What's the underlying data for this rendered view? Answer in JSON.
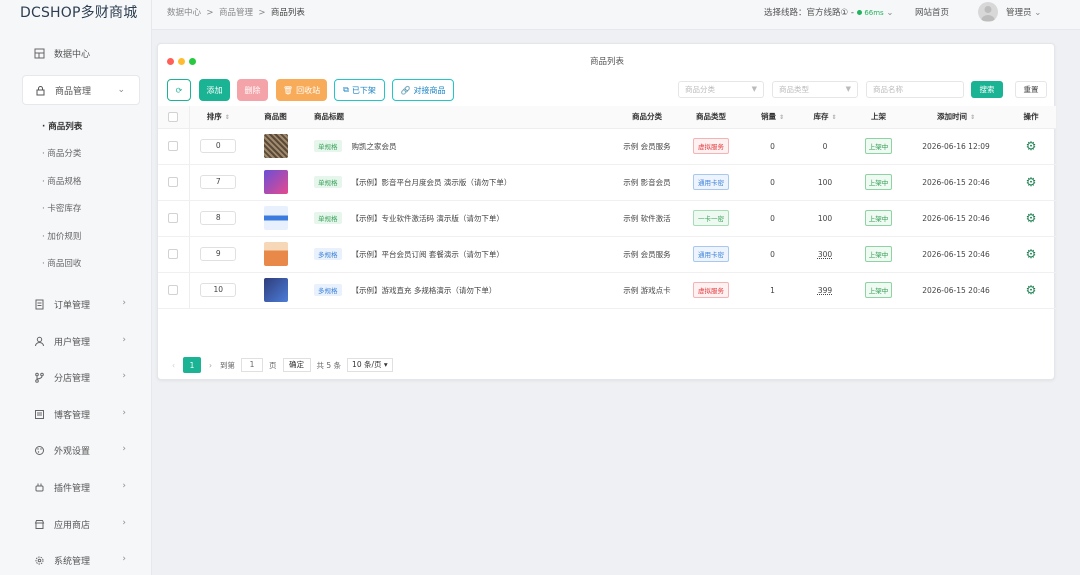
{
  "app": {
    "logo": "DCSHOP多财商城"
  },
  "sidebar": {
    "items": [
      {
        "label": "数据中心",
        "icon": "dashboard-icon"
      },
      {
        "label": "商品管理",
        "icon": "lock-icon",
        "open": true
      },
      {
        "label": "订单管理",
        "icon": "order-icon"
      },
      {
        "label": "用户管理",
        "icon": "user-icon"
      },
      {
        "label": "分店管理",
        "icon": "branch-icon"
      },
      {
        "label": "博客管理",
        "icon": "blog-icon"
      },
      {
        "label": "外观设置",
        "icon": "palette-icon"
      },
      {
        "label": "插件管理",
        "icon": "plugin-icon"
      },
      {
        "label": "应用商店",
        "icon": "store-icon"
      },
      {
        "label": "系统管理",
        "icon": "gear-icon"
      }
    ],
    "subitems": [
      "· 商品列表",
      "· 商品分类",
      "· 商品规格",
      "· 卡密库存",
      "· 加价规则",
      "· 商品回收"
    ]
  },
  "topbar": {
    "breadcrumb": [
      "数据中心",
      "商品管理",
      "商品列表"
    ],
    "route_label": "选择线路：",
    "route_value": "官方线路①",
    "latency": "66ms",
    "home_link": "网站首页",
    "admin": "管理员"
  },
  "window": {
    "title": "商品列表"
  },
  "toolbar": {
    "add": "添加",
    "delete": "删除",
    "recycle": "回收站",
    "off_shelf": "已下架",
    "dock": "对接商品"
  },
  "filters": {
    "category_placeholder": "商品分类",
    "type_placeholder": "商品类型",
    "name_placeholder": "商品名称",
    "search": "搜索",
    "reset": "重置"
  },
  "table": {
    "headers": [
      "排序",
      "商品图",
      "商品标题",
      "商品分类",
      "商品类型",
      "销量",
      "库存",
      "上架",
      "添加时间",
      "操作"
    ],
    "rows": [
      {
        "sort": "0",
        "spec": "单规格",
        "title": "购凯之家会员",
        "category": "示例 会员服务",
        "type": "虚拟服务",
        "sales": "0",
        "stock": "0",
        "status": "上架中",
        "time": "2026-06-16 12:09",
        "thumb_color": "#5b4a3a"
      },
      {
        "sort": "7",
        "spec": "单规格",
        "title": "【示例】影音平台月度会员 演示版（请勿下单）",
        "category": "示例 影音会员",
        "type": "通用卡密",
        "sales": "0",
        "stock": "100",
        "status": "上架中",
        "time": "2026-06-15 20:46",
        "thumb_color": "#6a4fd6"
      },
      {
        "sort": "8",
        "spec": "单规格",
        "title": "【示例】专业软件激活码 演示版（请勿下单）",
        "category": "示例 软件激活",
        "type": "一卡一密",
        "sales": "0",
        "stock": "100",
        "status": "上架中",
        "time": "2026-06-15 20:46",
        "thumb_color": "#3b7be0"
      },
      {
        "sort": "9",
        "spec": "多规格",
        "title": "【示例】平台会员订阅 套餐演示（请勿下单）",
        "category": "示例 会员服务",
        "type": "通用卡密",
        "sales": "0",
        "stock": "300",
        "status": "上架中",
        "time": "2026-06-15 20:46",
        "thumb_color": "#e8894a"
      },
      {
        "sort": "10",
        "spec": "多规格",
        "title": "【示例】游戏直充 多规格演示（请勿下单）",
        "category": "示例 游戏点卡",
        "type": "虚拟服务",
        "sales": "1",
        "stock": "399",
        "status": "上架中",
        "time": "2026-06-15 20:46",
        "thumb_color": "#2f3d7a"
      }
    ]
  },
  "pager": {
    "current": "1",
    "goto_label": "到第",
    "goto_value": "1",
    "page_unit": "页",
    "confirm": "确定",
    "total": "共 5 条",
    "page_size": "10 条/页"
  }
}
